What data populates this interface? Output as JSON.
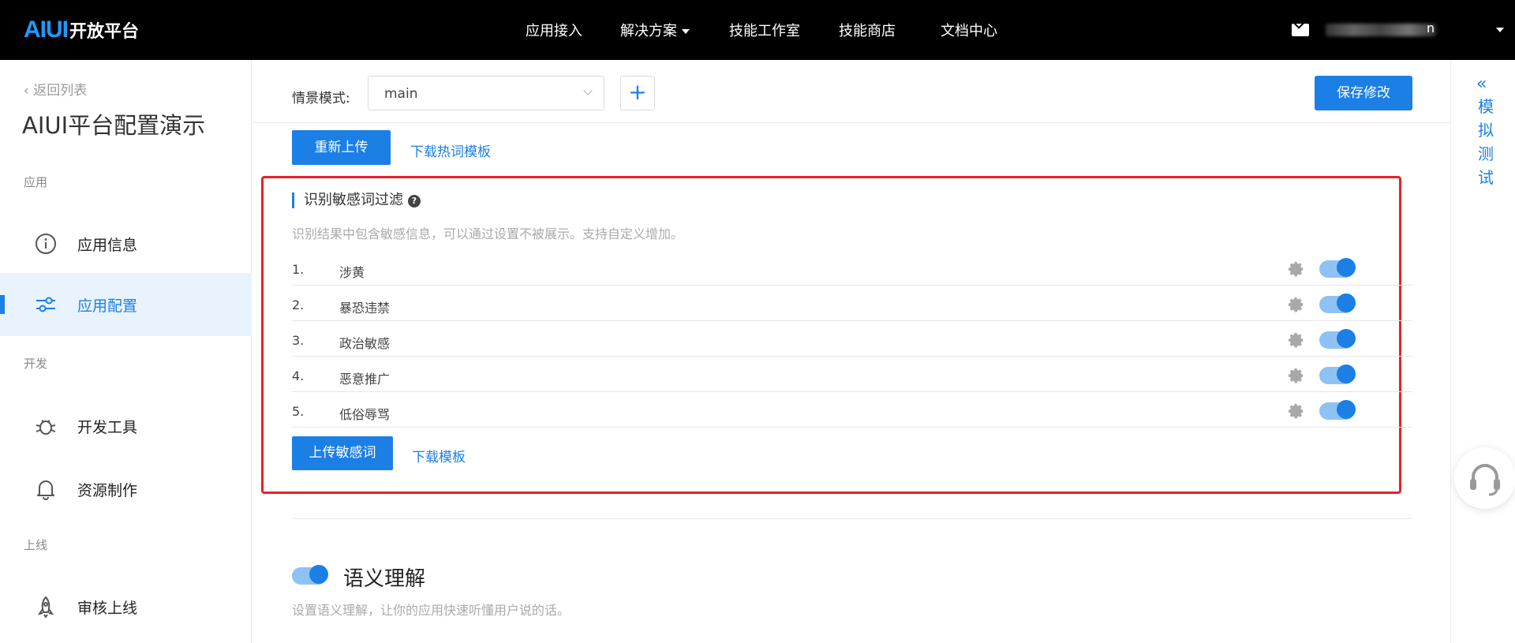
{
  "header": {
    "logo_mark": "AIUI",
    "logo_text": "开放平台",
    "nav": [
      "应用接入",
      "解决方案",
      "技能工作室",
      "技能商店",
      "文档中心"
    ],
    "user_suffix": "n"
  },
  "sidebar": {
    "back": "返回列表",
    "app_title": "AIUI平台配置演示",
    "sections": {
      "app": "应用",
      "dev": "开发",
      "online": "上线"
    },
    "items": [
      {
        "label": "应用信息",
        "icon": "info-icon"
      },
      {
        "label": "应用配置",
        "icon": "sliders-icon"
      },
      {
        "label": "开发工具",
        "icon": "bug-icon"
      },
      {
        "label": "资源制作",
        "icon": "bell-icon"
      },
      {
        "label": "审核上线",
        "icon": "rocket-icon"
      }
    ]
  },
  "scene": {
    "label": "情景模式:",
    "value": "main",
    "add": "+",
    "save": "保存修改"
  },
  "hotword": {
    "reupload": "重新上传",
    "download": "下载热词模板"
  },
  "sensitive": {
    "title": "识别敏感词过滤",
    "help": "?",
    "desc": "识别结果中包含敏感信息，可以通过设置不被展示。支持自定义增加。",
    "rows": [
      {
        "num": "1.",
        "name": "涉黄",
        "enabled": true
      },
      {
        "num": "2.",
        "name": "暴恐违禁",
        "enabled": true
      },
      {
        "num": "3.",
        "name": "政治敏感",
        "enabled": true
      },
      {
        "num": "4.",
        "name": "恶意推广",
        "enabled": true
      },
      {
        "num": "5.",
        "name": "低俗辱骂",
        "enabled": true
      }
    ],
    "upload": "上传敏感词",
    "download": "下载模板"
  },
  "semantic": {
    "title": "语义理解",
    "desc": "设置语义理解，让你的应用快速听懂用户说的话。",
    "enabled": true
  },
  "right_panel": {
    "chevron": "«",
    "label": "模拟测试"
  }
}
